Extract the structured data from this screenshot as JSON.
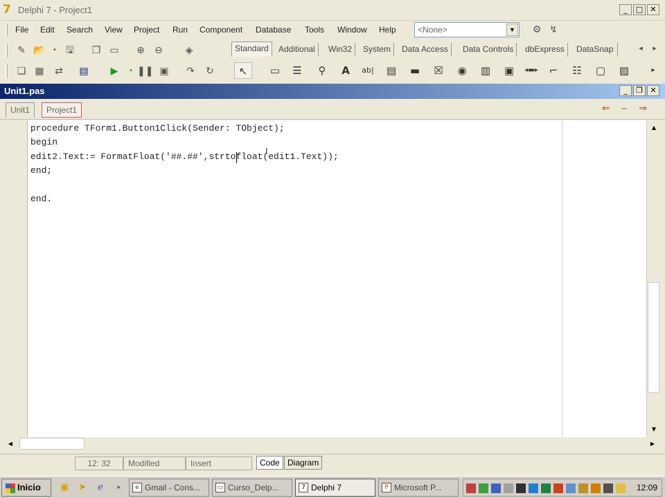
{
  "window": {
    "title": "Delphi 7 - Project1",
    "app_icon": "7"
  },
  "menu": {
    "items": [
      "File",
      "Edit",
      "Search",
      "View",
      "Project",
      "Run",
      "Component",
      "Database",
      "Tools",
      "Window",
      "Help"
    ]
  },
  "desktop_combo": {
    "value": "<None>"
  },
  "palette": {
    "tabs": [
      "Standard",
      "Additional",
      "Win32",
      "System",
      "Data Access",
      "Data Controls",
      "dbExpress",
      "DataSnap"
    ]
  },
  "editor": {
    "title": "Unit1.pas",
    "tabs": [
      "Unit1",
      "Project1"
    ],
    "code_lines": [
      "procedure TForm1.Button1Click(Sender: TObject);",
      "begin",
      "edit2.Text:= FormatFloat('##.##',strtofloat(edit1.Text));",
      "end;",
      "",
      "end."
    ]
  },
  "status": {
    "position": "12: 32",
    "modified": "Modified",
    "mode": "Insert",
    "tabs": [
      "Code",
      "Diagram"
    ]
  },
  "taskbar": {
    "start_label": "Inicio",
    "tasks": [
      "Gmail - Cons...",
      "Curso_Delp...",
      "Delphi 7",
      "Microsoft P..."
    ],
    "clock": "12:09"
  }
}
